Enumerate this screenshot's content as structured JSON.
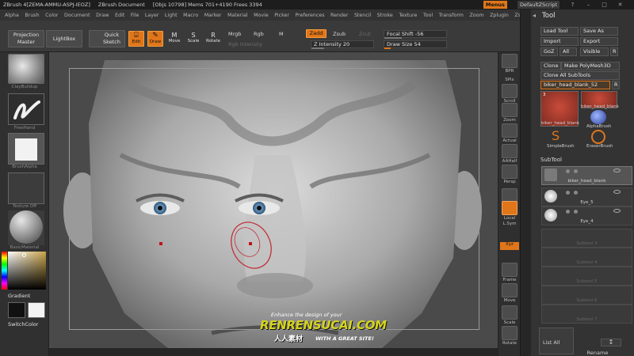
{
  "titlebar": {
    "app": "ZBrush 4[ZEMA-AMMU-ASPJ-IEOZ]",
    "doc": "ZBrush Document",
    "stats": "[Objs 10798]  Mems 701+4190  Frees 3394",
    "menus_btn": "Menus",
    "default_script": "DefaultZScript"
  },
  "menubar": [
    "Alpha",
    "Brush",
    "Color",
    "Document",
    "Draw",
    "Edit",
    "File",
    "Layer",
    "Light",
    "Macro",
    "Marker",
    "Material",
    "Movie",
    "Picker",
    "Preferences",
    "Render",
    "Stencil",
    "Stroke",
    "Texture",
    "Tool",
    "Transform",
    "Zoom",
    "Zplugin",
    "Zscript"
  ],
  "shelf": {
    "projection_master": "Projection Master",
    "lightbox": "LightBox",
    "quick_sketch": "Quick Sketch",
    "edit": "Edit",
    "draw": "Draw",
    "move": "Move",
    "scale": "Scale",
    "rotate": "Rotate",
    "mrgb": "Mrgb",
    "rgb": "Rgb",
    "m": "M",
    "rgb_intensity": "Rgb Intensity",
    "zadd": "Zadd",
    "zsub": "Zsub",
    "zcut": "Zcut",
    "z_intensity": "Z Intensity 20",
    "focal_shift": "Focal Shift -56",
    "draw_size": "Draw Size 54",
    "z_intensity_value": 20,
    "focal_shift_value": -56,
    "draw_size_value": 54
  },
  "left": {
    "brush": "ClayBuildup",
    "stroke": "FreeHand",
    "alpha": "BrushAlpha",
    "texture": "Texture Off",
    "material": "BasicMaterial",
    "gradient": "Gradient",
    "switch_color": "SwitchColor"
  },
  "right_tools": [
    "BPR",
    "SPix",
    "Scroll",
    "Zoom",
    "Actual",
    "AAHalf",
    "Persp",
    "Floor",
    "Local",
    "L.Sym",
    "Xyz",
    "Frame",
    "Move",
    "Scale",
    "Rotate"
  ],
  "tool_panel": {
    "title": "Tool",
    "load_tool": "Load Tool",
    "save_as": "Save As",
    "import": "Import",
    "export": "Export",
    "goz": "GoZ",
    "all": "All",
    "visible": "Visible",
    "r": "R",
    "clone": "Clone",
    "make_polymesh": "Make PolyMesh3D",
    "clone_all": "Clone  All SubTools",
    "current_tool": "biker_head_blank_52",
    "thumb_count": "3",
    "thumbs": [
      "biker_head_blank",
      "biker_head_blank",
      "AlphaBrush",
      "SimpleBrush",
      "EraserBrush"
    ],
    "subtool_header": "SubTool",
    "subtools": [
      "biker_head_blank",
      "Eye_5",
      "Eye_4",
      "Subtool 3",
      "Subtool 4",
      "Subtool 5",
      "Subtool 6",
      "Subtool 7"
    ],
    "list_all": "List All",
    "rename": "Rename"
  },
  "watermark": {
    "tagline": "Enhance the design of your",
    "brand": "RENRENSUCAI.COM",
    "cn": "人人素材",
    "slogan": "WITH A GREAT SITE!"
  },
  "colors": {
    "accent": "#e0761a",
    "panel": "#333333",
    "canvas": "#4a4a4a"
  }
}
